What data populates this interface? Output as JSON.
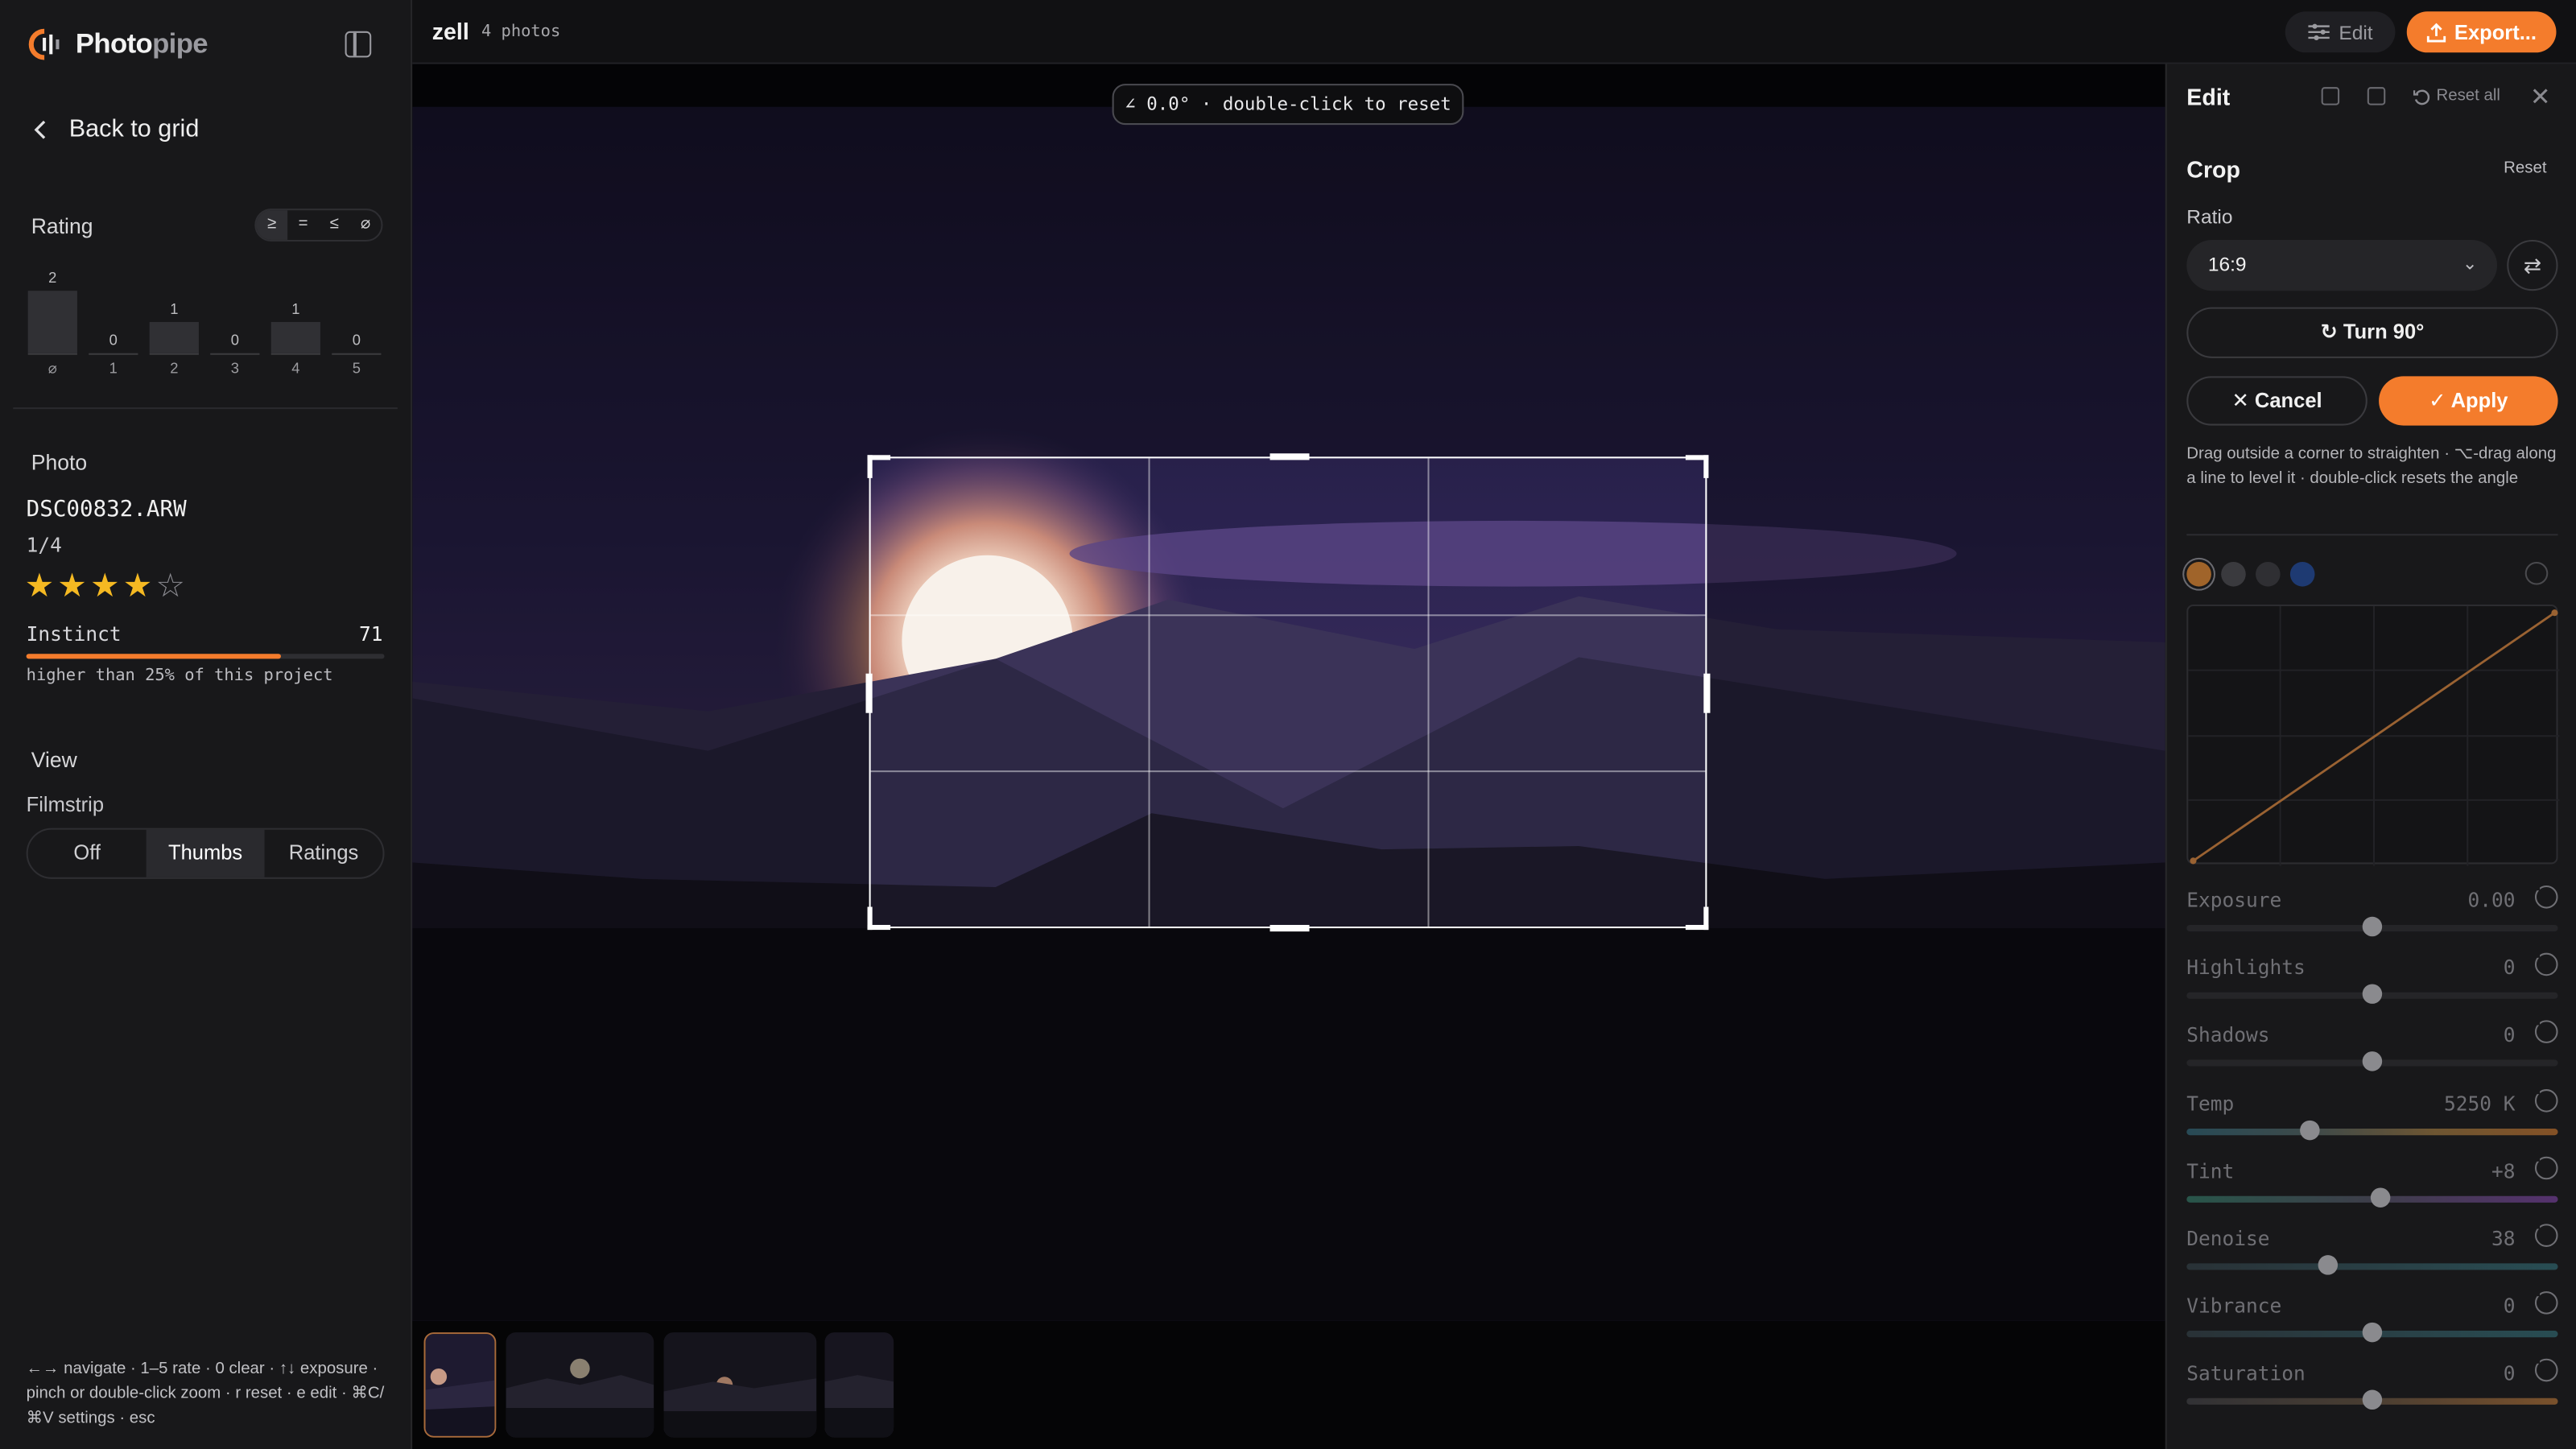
{
  "app": {
    "name_main": "Photo",
    "name_accent": "pipe",
    "project": "zell",
    "photo_count": "4 photos"
  },
  "sidebar": {
    "back_label": "Back to grid",
    "rating": {
      "title": "Rating",
      "operators": [
        "≥",
        "=",
        "≤",
        "⌀"
      ],
      "histogram": [
        {
          "label": "⌀",
          "count": "2"
        },
        {
          "label": "1",
          "count": "0"
        },
        {
          "label": "2",
          "count": "1"
        },
        {
          "label": "3",
          "count": "0"
        },
        {
          "label": "4",
          "count": "1"
        },
        {
          "label": "5",
          "count": "0"
        }
      ]
    },
    "photo": {
      "title": "Photo",
      "filename": "DSC00832.ARW",
      "position": "1/4",
      "stars": 4,
      "stars_max": 5,
      "instinct_label": "Instinct",
      "instinct_value": "71",
      "instinct_fraction": 0.71,
      "instinct_note": "higher than 25% of this project"
    },
    "view": {
      "title": "View",
      "filmstrip_label": "Filmstrip",
      "options": [
        "Off",
        "Thumbs",
        "Ratings"
      ],
      "selected": "Thumbs"
    },
    "shortcuts": "←→ navigate · 1–5 rate · 0 clear · ↑↓ exposure · pinch or double-click zoom · r reset · e edit · ⌘C/⌘V settings · esc"
  },
  "topbar": {
    "edit_label": "Edit",
    "export_label": "Export..."
  },
  "canvas": {
    "angle_hint": "∠ 0.0° · double-click to reset"
  },
  "panel": {
    "title": "Edit",
    "reset_all": "Reset all",
    "crop": {
      "title": "Crop",
      "reset": "Reset",
      "ratio_label": "Ratio",
      "ratio_value": "16:9",
      "turn_label": "Turn 90°",
      "cancel_label": "Cancel",
      "apply_label": "Apply",
      "help": "Drag outside a corner to straighten · ⌥-drag along a line to level it · double-click resets the angle"
    },
    "curve_channels": [
      "#a0642a",
      "#3a3a3e",
      "#2f2f33",
      "#1e3a72"
    ],
    "sliders": [
      {
        "label": "Exposure",
        "value": "0.00",
        "position": 0.5,
        "track": "plain"
      },
      {
        "label": "Highlights",
        "value": "0",
        "position": 0.5,
        "track": "plain"
      },
      {
        "label": "Shadows",
        "value": "0",
        "position": 0.5,
        "track": "plain"
      },
      {
        "label": "Temp",
        "value": "5250 K",
        "position": 0.33,
        "track": "temp"
      },
      {
        "label": "Tint",
        "value": "+8",
        "position": 0.52,
        "track": "tint"
      },
      {
        "label": "Denoise",
        "value": "38",
        "position": 0.38,
        "track": "teal"
      },
      {
        "label": "Vibrance",
        "value": "0",
        "position": 0.5,
        "track": "teal"
      },
      {
        "label": "Saturation",
        "value": "0",
        "position": 0.5,
        "track": "sat"
      }
    ]
  },
  "colors": {
    "accent": "#f47c2c",
    "star": "#f5b922"
  }
}
